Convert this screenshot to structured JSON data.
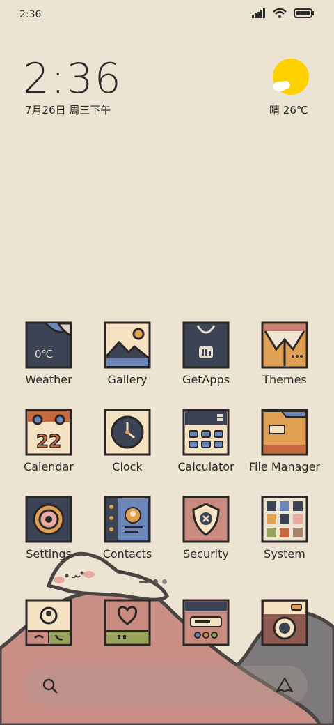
{
  "status_bar": {
    "time": "2:36"
  },
  "home": {
    "clock": "2:36",
    "date": "7月26日 周三下午",
    "weather": {
      "condition": "晴",
      "temp": "26℃"
    }
  },
  "apps": [
    {
      "label": "Weather",
      "icon": "weather-icon",
      "badge_text": "0℃"
    },
    {
      "label": "Gallery",
      "icon": "gallery-icon"
    },
    {
      "label": "GetApps",
      "icon": "getapps-icon"
    },
    {
      "label": "Themes",
      "icon": "themes-icon"
    },
    {
      "label": "Calendar",
      "icon": "calendar-icon",
      "badge_text": "22"
    },
    {
      "label": "Clock",
      "icon": "clock-icon"
    },
    {
      "label": "Calculator",
      "icon": "calculator-icon"
    },
    {
      "label": "File Manager",
      "icon": "file-manager-icon"
    },
    {
      "label": "Settings",
      "icon": "settings-icon"
    },
    {
      "label": "Contacts",
      "icon": "contacts-icon"
    },
    {
      "label": "Security",
      "icon": "security-icon"
    },
    {
      "label": "System",
      "icon": "system-folder-icon"
    }
  ],
  "dock": [
    {
      "icon": "phone-icon"
    },
    {
      "icon": "messages-icon"
    },
    {
      "icon": "browser-icon"
    },
    {
      "icon": "camera-icon"
    }
  ],
  "pager": {
    "pages": 3,
    "current": 2
  },
  "colors": {
    "background": "#ece3d3",
    "navy": "#3c4354",
    "blue": "#6c86b8",
    "orange": "#d79b50",
    "rose": "#c98a80",
    "green": "#97a35a"
  }
}
